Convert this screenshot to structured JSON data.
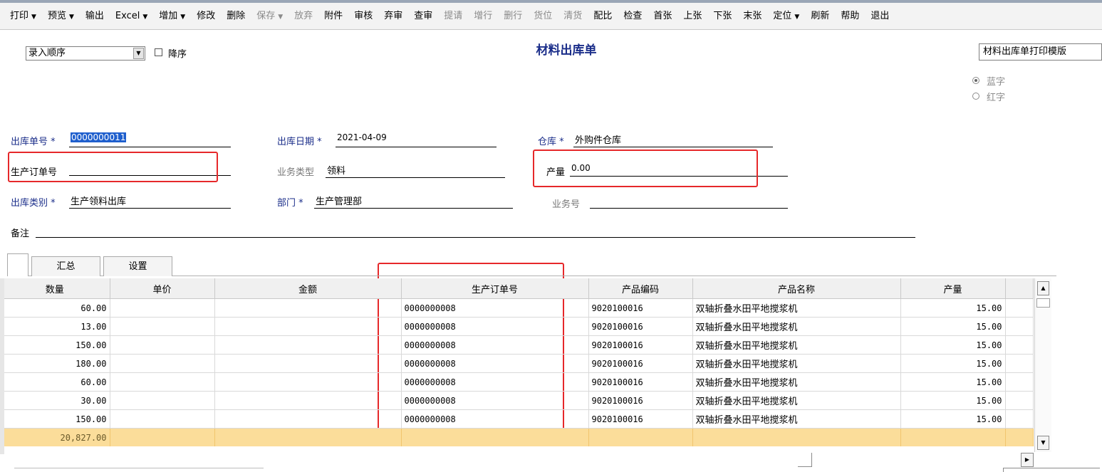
{
  "toolbar": [
    {
      "label": "打印",
      "dropdown": true,
      "disabled": false
    },
    {
      "label": "预览",
      "dropdown": true,
      "disabled": false
    },
    {
      "label": "输出",
      "dropdown": false,
      "disabled": false
    },
    {
      "label": "Excel",
      "dropdown": true,
      "disabled": false
    },
    {
      "label": "增加",
      "dropdown": true,
      "disabled": false
    },
    {
      "label": "修改",
      "dropdown": false,
      "disabled": false
    },
    {
      "label": "删除",
      "dropdown": false,
      "disabled": false
    },
    {
      "label": "保存",
      "dropdown": true,
      "disabled": true
    },
    {
      "label": "放弃",
      "dropdown": false,
      "disabled": true
    },
    {
      "label": "附件",
      "dropdown": false,
      "disabled": false
    },
    {
      "label": "审核",
      "dropdown": false,
      "disabled": false
    },
    {
      "label": "弃审",
      "dropdown": false,
      "disabled": false
    },
    {
      "label": "查审",
      "dropdown": false,
      "disabled": false
    },
    {
      "label": "提请",
      "dropdown": false,
      "disabled": true
    },
    {
      "label": "增行",
      "dropdown": false,
      "disabled": true
    },
    {
      "label": "删行",
      "dropdown": false,
      "disabled": true
    },
    {
      "label": "货位",
      "dropdown": false,
      "disabled": true
    },
    {
      "label": "清货",
      "dropdown": false,
      "disabled": true
    },
    {
      "label": "配比",
      "dropdown": false,
      "disabled": false
    },
    {
      "label": "检查",
      "dropdown": false,
      "disabled": false
    },
    {
      "label": "首张",
      "dropdown": false,
      "disabled": false
    },
    {
      "label": "上张",
      "dropdown": false,
      "disabled": false
    },
    {
      "label": "下张",
      "dropdown": false,
      "disabled": false
    },
    {
      "label": "末张",
      "dropdown": false,
      "disabled": false
    },
    {
      "label": "定位",
      "dropdown": true,
      "disabled": false
    },
    {
      "label": "刷新",
      "dropdown": false,
      "disabled": false
    },
    {
      "label": "帮助",
      "dropdown": false,
      "disabled": false
    },
    {
      "label": "退出",
      "dropdown": false,
      "disabled": false
    }
  ],
  "sort": {
    "selected": "录入顺序",
    "descending_label": "降序"
  },
  "title": "材料出库单",
  "template": "材料出库单打印模版",
  "color_mode": {
    "blue_label": "蓝字",
    "red_label": "红字",
    "selected": "蓝字"
  },
  "header": {
    "outbound_no": {
      "label": "出库单号",
      "required": "*",
      "value": "0000000011"
    },
    "outbound_date": {
      "label": "出库日期",
      "required": "*",
      "value": "2021-04-09"
    },
    "warehouse": {
      "label": "仓库",
      "required": "*",
      "value": "外购件仓库"
    },
    "production_order": {
      "label": "生产订单号",
      "value": ""
    },
    "business_type": {
      "label": "业务类型",
      "value": "领料"
    },
    "output_qty": {
      "label": "产量",
      "value": "0.00"
    },
    "outbound_type": {
      "label": "出库类别",
      "required": "*",
      "value": "生产领料出库"
    },
    "department": {
      "label": "部门",
      "required": "*",
      "value": "生产管理部"
    },
    "business_no": {
      "label": "业务号",
      "value": ""
    },
    "remark": {
      "label": "备注",
      "value": ""
    }
  },
  "tabs": [
    "汇总",
    "设置"
  ],
  "grid": {
    "columns": [
      "数量",
      "单价",
      "金额",
      "生产订单号",
      "产品编码",
      "产品名称",
      "产量"
    ],
    "rows": [
      [
        "60.00",
        "",
        "",
        "0000000008",
        "9020100016",
        "双轴折叠水田平地搅浆机",
        "15.00"
      ],
      [
        "13.00",
        "",
        "",
        "0000000008",
        "9020100016",
        "双轴折叠水田平地搅浆机",
        "15.00"
      ],
      [
        "150.00",
        "",
        "",
        "0000000008",
        "9020100016",
        "双轴折叠水田平地搅浆机",
        "15.00"
      ],
      [
        "180.00",
        "",
        "",
        "0000000008",
        "9020100016",
        "双轴折叠水田平地搅浆机",
        "15.00"
      ],
      [
        "60.00",
        "",
        "",
        "0000000008",
        "9020100016",
        "双轴折叠水田平地搅浆机",
        "15.00"
      ],
      [
        "30.00",
        "",
        "",
        "0000000008",
        "9020100016",
        "双轴折叠水田平地搅浆机",
        "15.00"
      ],
      [
        "150.00",
        "",
        "",
        "0000000008",
        "9020100016",
        "双轴折叠水田平地搅浆机",
        "15.00"
      ]
    ],
    "total": [
      "20,827.00",
      "",
      "",
      "",
      "",
      "",
      ""
    ]
  },
  "colors": {
    "label_blue": "#1b2e8a",
    "highlight_red": "#e6282a",
    "total_row": "#fbdd9a",
    "selection": "#1f5fcd"
  }
}
